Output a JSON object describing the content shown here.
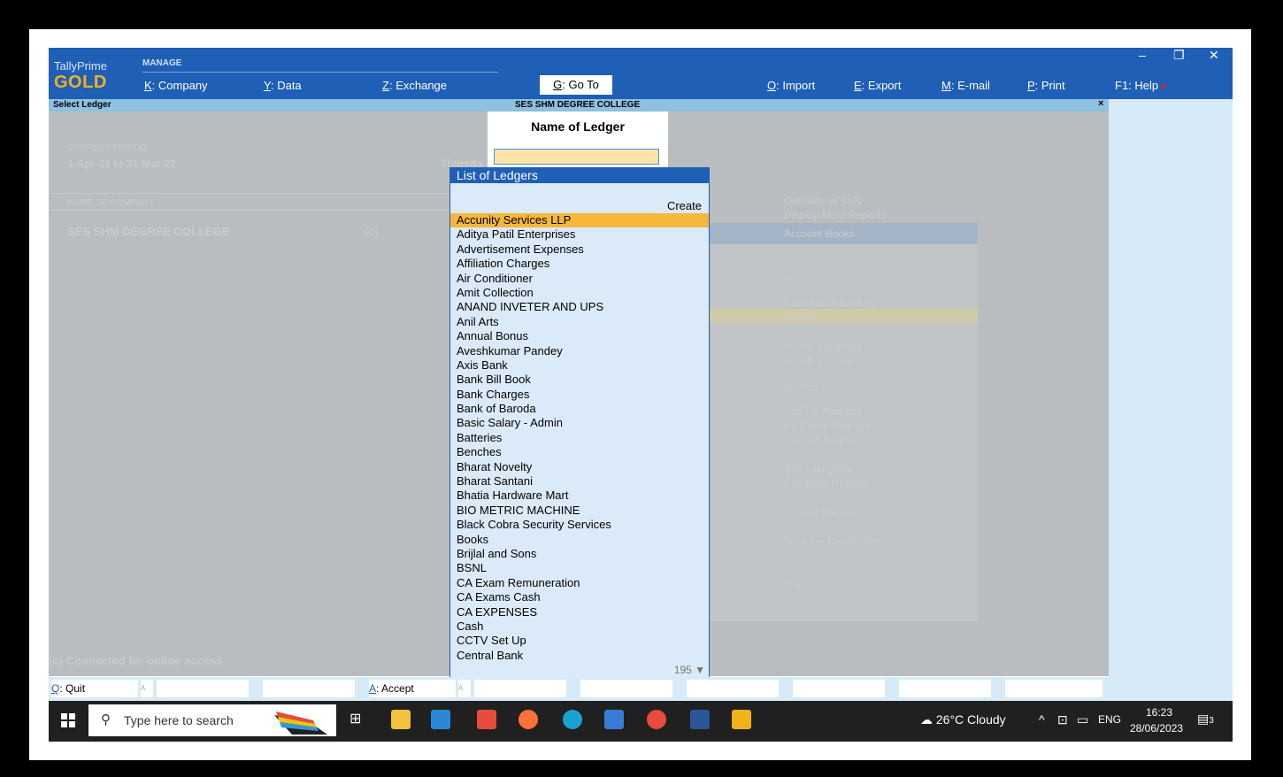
{
  "app": {
    "name": "TallyPrime",
    "edition": "GOLD",
    "manage_label": "MANAGE",
    "menu": [
      {
        "key": "K",
        "label": "Company"
      },
      {
        "key": "Y",
        "label": "Data"
      },
      {
        "key": "Z",
        "label": "Exchange"
      },
      {
        "key": "G",
        "label": "Go To"
      },
      {
        "key": "O",
        "label": "Import"
      },
      {
        "key": "E",
        "label": "Export"
      },
      {
        "key": "M",
        "label": "E-mail"
      },
      {
        "key": "P",
        "label": "Print"
      },
      {
        "key": "F1",
        "label": "Help"
      }
    ],
    "window_controls": [
      "–",
      "❐",
      "✕"
    ]
  },
  "title_strip": {
    "left": "Select Ledger",
    "center": "SES SHM DEGREE COLLEGE",
    "close": "×"
  },
  "background": {
    "current_period_label": "CURRENT PERIOD",
    "current_period": "1-Apr-21 to 31-Mar-22",
    "day": "Thursda",
    "name_of_company_label": "NAME OF COMPANY",
    "company": "SES SHM DEGREE COLLEGE",
    "company_suffix": "(c)",
    "footer_note": "(c) Connected for online access",
    "gateway": {
      "title": "Gateway of Tally",
      "subtitle": "Display More Reports",
      "selected": "Account Books",
      "summary_label": "SUMMARY",
      "items_a": [
        "Cash/Bank Book(s)",
        "Ledger"
      ],
      "items_b": [
        "Group Summary",
        "Group Vouchers"
      ],
      "registers_label": "REGISTERS",
      "items_c": [
        "ConTra Register",
        "PaYment Register",
        "Receipt Register"
      ],
      "items_d": [
        "Sales Register",
        "Purchase Register"
      ],
      "items_e": [
        "Journal Register"
      ],
      "items_f": [
        "VoUcher Clarification"
      ],
      "quit": "Quit"
    }
  },
  "ledger_prompt": {
    "title": "Name of Ledger",
    "value": ""
  },
  "ledger_list": {
    "title": "List of Ledgers",
    "create_label": "Create",
    "count": "195 ▼",
    "items": [
      "Accunity Services LLP",
      "Aditya Patil Enterprises",
      "Advertisement Expenses",
      "Affiliation Charges",
      "Air Conditioner",
      "Amit Collection",
      "ANAND INVETER AND UPS",
      "Anil Arts",
      "Annual Bonus",
      "Aveshkumar Pandey",
      "Axis Bank",
      "Bank Bill Book",
      "Bank Charges",
      "Bank of Baroda",
      "Basic Salary - Admin",
      "Batteries",
      "Benches",
      "Bharat Novelty",
      "Bharat Santani",
      "Bhatia Hardware Mart",
      "BIO METRIC MACHINE",
      "Black Cobra Security Services",
      "Books",
      "Brijlal and Sons",
      "BSNL",
      "CA Exam Remuneration",
      "CA Exams Cash",
      "CA EXPENSES",
      "Cash",
      "CCTV Set Up",
      "Central Bank"
    ],
    "selected_index": 0
  },
  "bottom_bar": {
    "quit": {
      "key": "Q",
      "label": "Quit"
    },
    "accept": {
      "key": "A",
      "label": "Accept"
    },
    "separator": "A"
  },
  "taskbar": {
    "search_placeholder": "Type here to search",
    "weather": "26°C  Cloudy",
    "lang": "ENG",
    "time": "16:23",
    "date": "28/06/2023",
    "notifications": "3"
  },
  "colors": {
    "tally_blue": "#1f5fb6",
    "gold": "#f2b21c",
    "selection": "#f6b73c",
    "list_bg": "#dbeaf8"
  }
}
